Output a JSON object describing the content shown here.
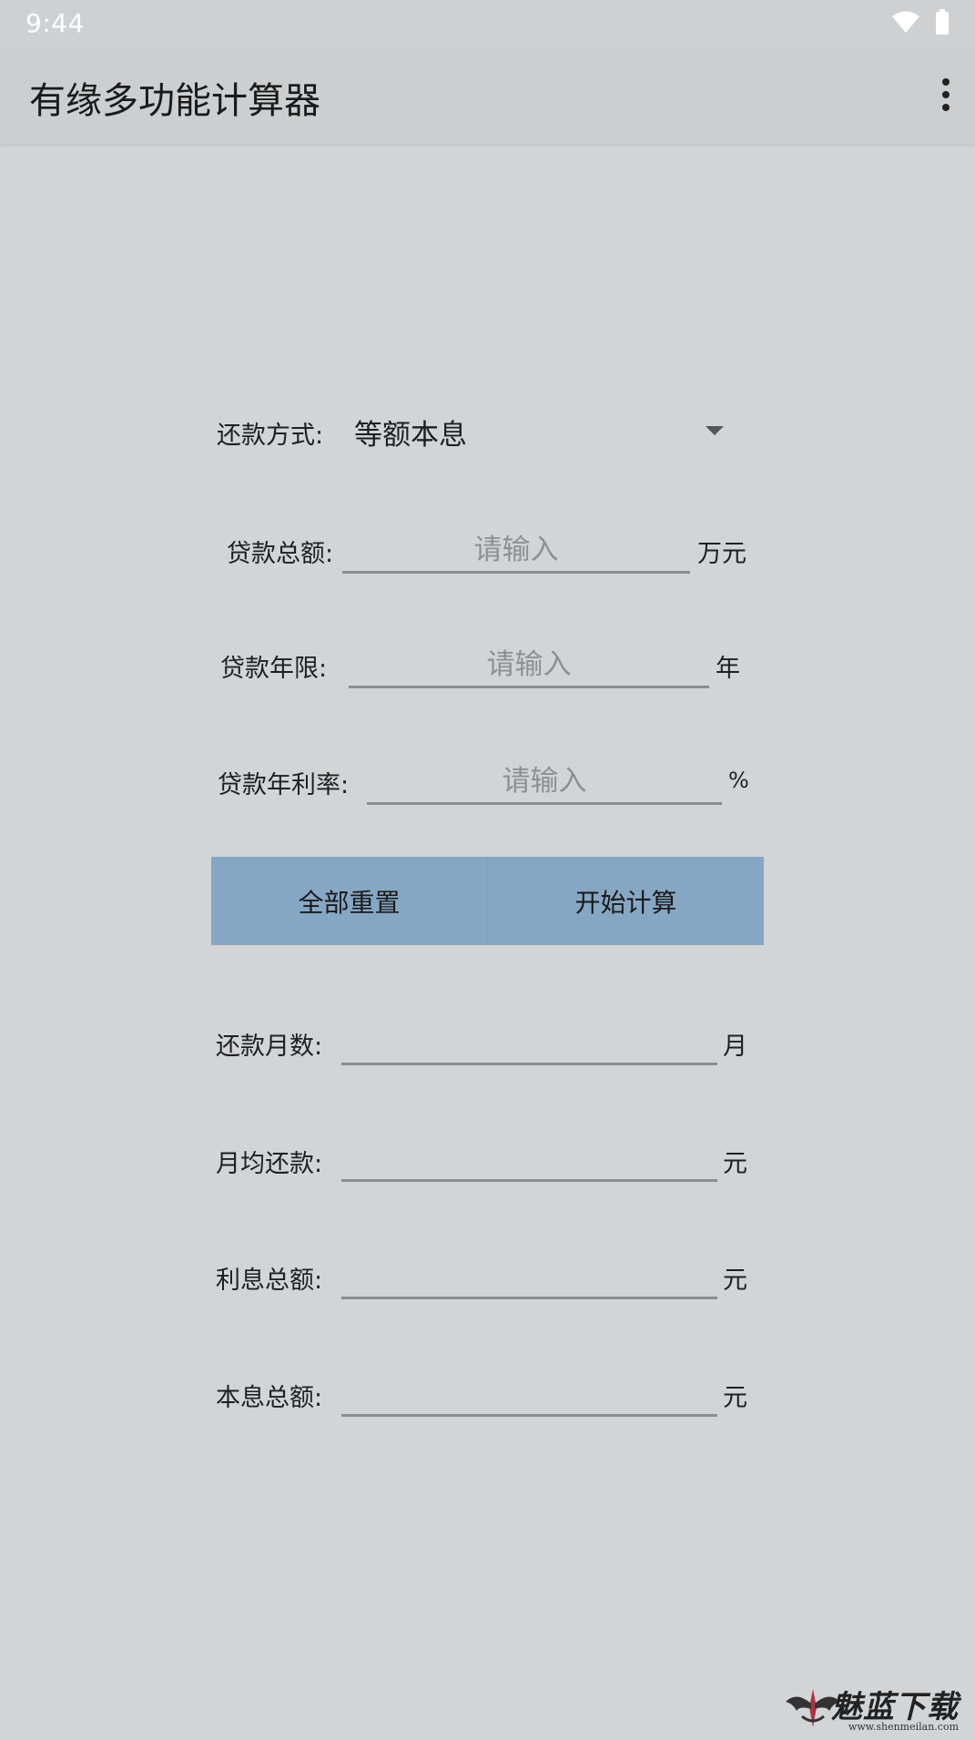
{
  "status_bar": {
    "time": "9:44"
  },
  "app_bar": {
    "title": "有缘多功能计算器"
  },
  "form": {
    "repayment_method": {
      "label": "还款方式:",
      "selected": "等额本息"
    },
    "loan_amount": {
      "label": "贷款总额:",
      "placeholder": "请输入",
      "value": "",
      "unit": "万元"
    },
    "loan_years": {
      "label": "贷款年限:",
      "placeholder": "请输入",
      "value": "",
      "unit": "年"
    },
    "annual_rate": {
      "label": "贷款年利率:",
      "placeholder": "请输入",
      "value": "",
      "unit": "%"
    }
  },
  "buttons": {
    "reset": "全部重置",
    "calculate": "开始计算"
  },
  "results": {
    "months": {
      "label": "还款月数:",
      "value": "",
      "unit": "月"
    },
    "monthly_payment": {
      "label": "月均还款:",
      "value": "",
      "unit": "元"
    },
    "total_interest": {
      "label": "利息总额:",
      "value": "",
      "unit": "元"
    },
    "total_payment": {
      "label": "本息总额:",
      "value": "",
      "unit": "元"
    }
  },
  "watermark": {
    "text": "魅蓝下载",
    "url": "www.shenmeilan.com"
  },
  "colors": {
    "background": "#d3d4d6",
    "button_bg": "#86a7c4",
    "underline": "#8c8d8f"
  },
  "icons": {
    "wifi": "wifi-icon",
    "battery": "battery-icon",
    "more": "more-vertical-icon",
    "dropdown": "dropdown-arrow-icon"
  }
}
